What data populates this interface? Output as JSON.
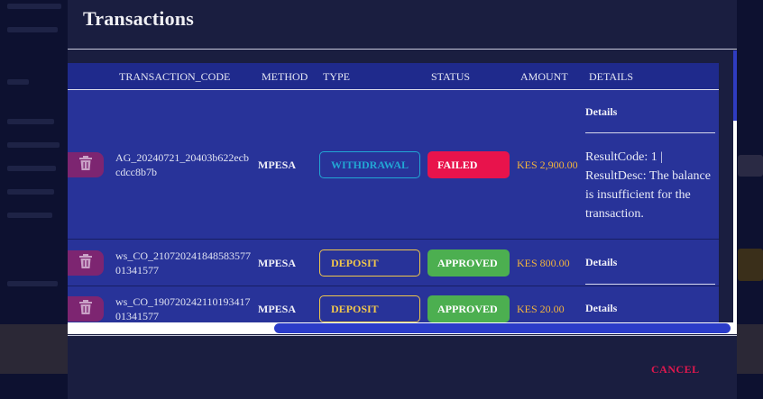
{
  "modal": {
    "title": "Transactions",
    "cancel_label": "CANCEL"
  },
  "table": {
    "columns": [
      "TRANSACTION_CODE",
      "METHOD",
      "TYPE",
      "STATUS",
      "AMOUNT",
      "DETAILS"
    ],
    "rows": [
      {
        "code": "AG_20240721_20403b622ecbcdcc8b7b",
        "method": "MPESA",
        "type": "WITHDRAWAL",
        "status": "FAILED",
        "amount": "KES 2,900.00",
        "details_label": "Details",
        "details_text": "ResultCode: 1 | ResultDesc: The balance is insufficient for the transaction."
      },
      {
        "code": "ws_CO_21072024184858357701341577",
        "method": "MPESA",
        "type": "DEPOSIT",
        "status": "APPROVED",
        "amount": "KES 800.00",
        "details_label": "Details"
      },
      {
        "code": "ws_CO_19072024211019341701341577",
        "method": "MPESA",
        "type": "DEPOSIT",
        "status": "APPROVED",
        "amount": "KES 20.00",
        "details_label": "Details"
      }
    ]
  },
  "icons": {
    "row_action": "trash-icon"
  },
  "colors": {
    "withdrawal": "#22a7d4",
    "deposit": "#f2c84b",
    "failed": "#e8134c",
    "approved": "#4caf50",
    "amount": "#f2b33d",
    "cancel": "#e0184e"
  }
}
